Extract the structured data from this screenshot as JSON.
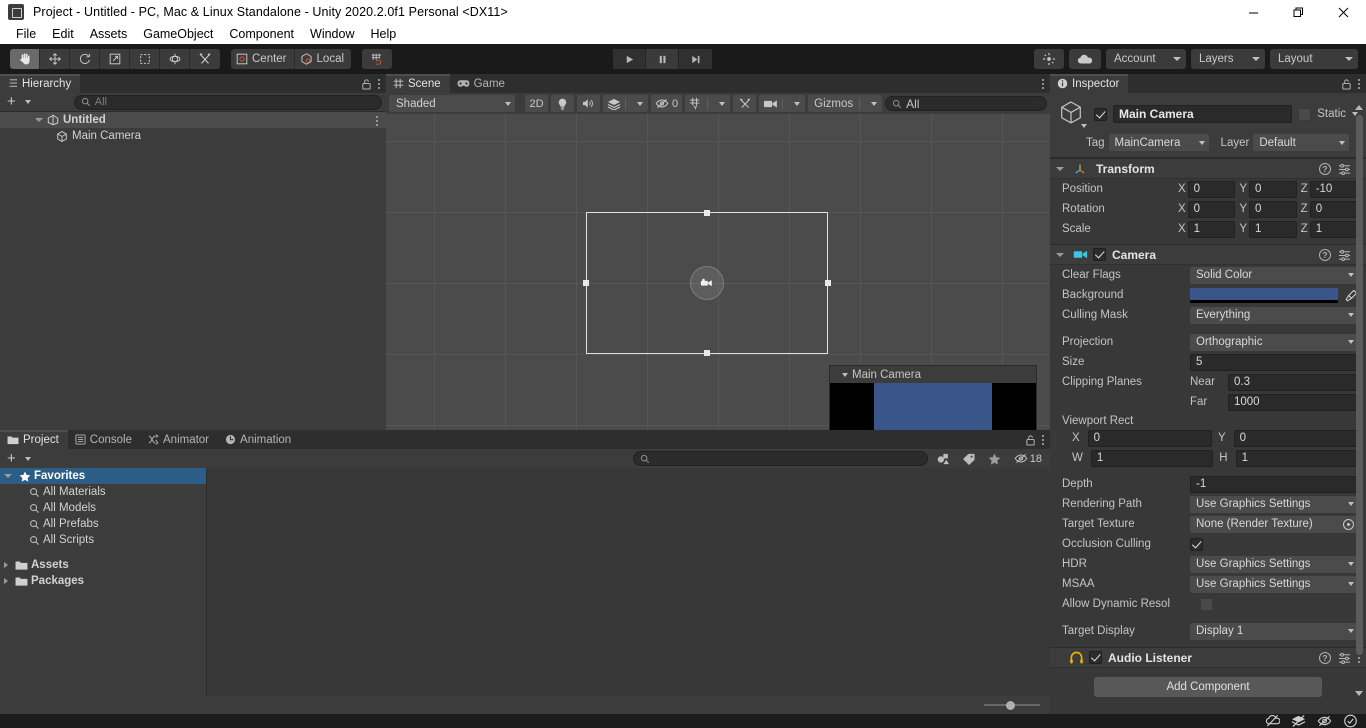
{
  "window": {
    "title": "Project - Untitled - PC, Mac & Linux Standalone - Unity 2020.2.0f1 Personal <DX11>",
    "minimize_label": "Minimize",
    "restore_label": "Restore",
    "close_label": "Close"
  },
  "menu": {
    "items": [
      "File",
      "Edit",
      "Assets",
      "GameObject",
      "Component",
      "Window",
      "Help"
    ]
  },
  "toolbar": {
    "tools": [
      {
        "name": "hand-tool",
        "label": "Hand"
      },
      {
        "name": "move-tool",
        "label": "Move"
      },
      {
        "name": "rotate-tool",
        "label": "Rotate"
      },
      {
        "name": "scale-tool",
        "label": "Scale"
      },
      {
        "name": "rect-tool",
        "label": "Rect"
      },
      {
        "name": "transform-tool",
        "label": "Transform"
      },
      {
        "name": "custom-editor-tool",
        "label": "Custom"
      }
    ],
    "pivot_label": "Center",
    "handle_label": "Local",
    "snap_label": "Grid Snapping",
    "play_label": "Play",
    "pause_label": "Pause",
    "step_label": "Step",
    "services_label": "Services",
    "cloud_label": "Collab",
    "account_label": "Account",
    "layers_label": "Layers",
    "layout_label": "Layout"
  },
  "hierarchy": {
    "tab_label": "Hierarchy",
    "search_placeholder": "All",
    "create_label": "+",
    "scene_name": "Untitled",
    "objects": [
      {
        "label": "Main Camera"
      }
    ]
  },
  "scene": {
    "tabs": [
      {
        "label": "Scene",
        "icon": "grid-icon",
        "active": true
      },
      {
        "label": "Game",
        "icon": "gamepad-icon",
        "active": false
      }
    ],
    "shading_mode": "Shaded",
    "mode_2d": "2D",
    "lighting_label": "Lighting",
    "audio_label": "Audio",
    "fx_label": "Effects",
    "hidden_count": "0",
    "grid_label": "Grid",
    "tools_label": "Tools",
    "camera_label": "Camera",
    "gizmos_label": "Gizmos",
    "search_placeholder": "All",
    "camera_preview_title": "Main Camera",
    "camera_preview_bg": "#39558a"
  },
  "project": {
    "tabs": [
      {
        "label": "Project",
        "icon": "folder-icon",
        "active": true
      },
      {
        "label": "Console",
        "icon": "console-icon",
        "active": false
      },
      {
        "label": "Animator",
        "icon": "animator-icon",
        "active": false
      },
      {
        "label": "Animation",
        "icon": "clock-icon",
        "active": false
      }
    ],
    "create_label": "+",
    "search_placeholder": "",
    "badge_count": "18",
    "tree": [
      {
        "label": "Favorites",
        "type": "favorites",
        "selected": true,
        "expanded": true,
        "depth": 0
      },
      {
        "label": "All Materials",
        "type": "search",
        "selected": false,
        "depth": 1
      },
      {
        "label": "All Models",
        "type": "search",
        "selected": false,
        "depth": 1
      },
      {
        "label": "All Prefabs",
        "type": "search",
        "selected": false,
        "depth": 1
      },
      {
        "label": "All Scripts",
        "type": "search",
        "selected": false,
        "depth": 1
      },
      {
        "label": "Assets",
        "type": "folder",
        "selected": false,
        "expanded": false,
        "depth": 0
      },
      {
        "label": "Packages",
        "type": "folder",
        "selected": false,
        "expanded": false,
        "depth": 0
      }
    ]
  },
  "inspector": {
    "tab_label": "Inspector",
    "object_name": "Main Camera",
    "object_enabled": true,
    "static_label": "Static",
    "static_checked": false,
    "tag_label": "Tag",
    "tag_value": "MainCamera",
    "layer_label": "Layer",
    "layer_value": "Default",
    "transform": {
      "title": "Transform",
      "rows": [
        {
          "label": "Position",
          "x": "0",
          "y": "0",
          "z": "-10"
        },
        {
          "label": "Rotation",
          "x": "0",
          "y": "0",
          "z": "0"
        },
        {
          "label": "Scale",
          "x": "1",
          "y": "1",
          "z": "1"
        }
      ]
    },
    "camera": {
      "title": "Camera",
      "enabled": true,
      "clear_flags_label": "Clear Flags",
      "clear_flags_value": "Solid Color",
      "background_label": "Background",
      "background_color": "#39558a",
      "culling_mask_label": "Culling Mask",
      "culling_mask_value": "Everything",
      "projection_label": "Projection",
      "projection_value": "Orthographic",
      "size_label": "Size",
      "size_value": "5",
      "clipping_planes_label": "Clipping Planes",
      "near_label": "Near",
      "near_value": "0.3",
      "far_label": "Far",
      "far_value": "1000",
      "viewport_rect_label": "Viewport Rect",
      "viewport_x_label": "X",
      "viewport_x": "0",
      "viewport_y_label": "Y",
      "viewport_y": "0",
      "viewport_w_label": "W",
      "viewport_w": "1",
      "viewport_h_label": "H",
      "viewport_h": "1",
      "depth_label": "Depth",
      "depth_value": "-1",
      "rendering_path_label": "Rendering Path",
      "rendering_path_value": "Use Graphics Settings",
      "target_texture_label": "Target Texture",
      "target_texture_value": "None (Render Texture)",
      "occlusion_culling_label": "Occlusion Culling",
      "occlusion_culling_checked": true,
      "hdr_label": "HDR",
      "hdr_value": "Use Graphics Settings",
      "msaa_label": "MSAA",
      "msaa_value": "Use Graphics Settings",
      "dynamic_resolution_label": "Allow Dynamic Resol",
      "dynamic_resolution_checked": false,
      "target_display_label": "Target Display",
      "target_display_value": "Display 1"
    },
    "audio_listener": {
      "title": "Audio Listener",
      "enabled": true
    },
    "add_component_label": "Add Component"
  },
  "statusbar": {
    "icons": [
      "collab-error-icon",
      "layers-off-icon",
      "eye-off-icon",
      "check-circle-icon"
    ]
  }
}
